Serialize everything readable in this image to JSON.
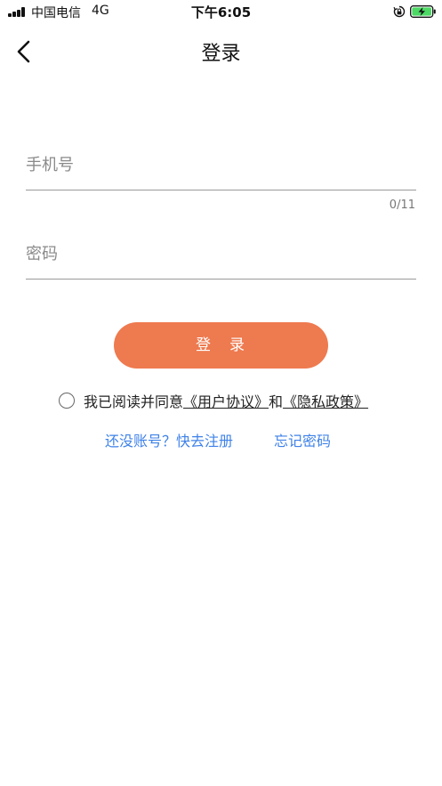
{
  "status_bar": {
    "carrier": "中国电信",
    "network": "4G",
    "time": "下午6:05",
    "icons": [
      "signal-icon",
      "rotation-lock-icon",
      "battery-charging-icon"
    ]
  },
  "nav": {
    "back_icon": "chevron-left-icon",
    "title": "登录"
  },
  "form": {
    "phone": {
      "placeholder": "手机号",
      "value": "",
      "counter": "0/11"
    },
    "password": {
      "placeholder": "密码",
      "value": ""
    },
    "login_button": "登　录"
  },
  "agreement": {
    "checked": false,
    "prefix": "我已阅读并同意",
    "user_agreement": "《用户协议》",
    "conjunction": "和",
    "privacy_policy": "《隐私政策》"
  },
  "links": {
    "register": "还没账号？快去注册",
    "forgot_password": "忘记密码"
  },
  "colors": {
    "accent": "#ee7a4f",
    "link": "#3f82e8",
    "background": "#ffffff"
  }
}
